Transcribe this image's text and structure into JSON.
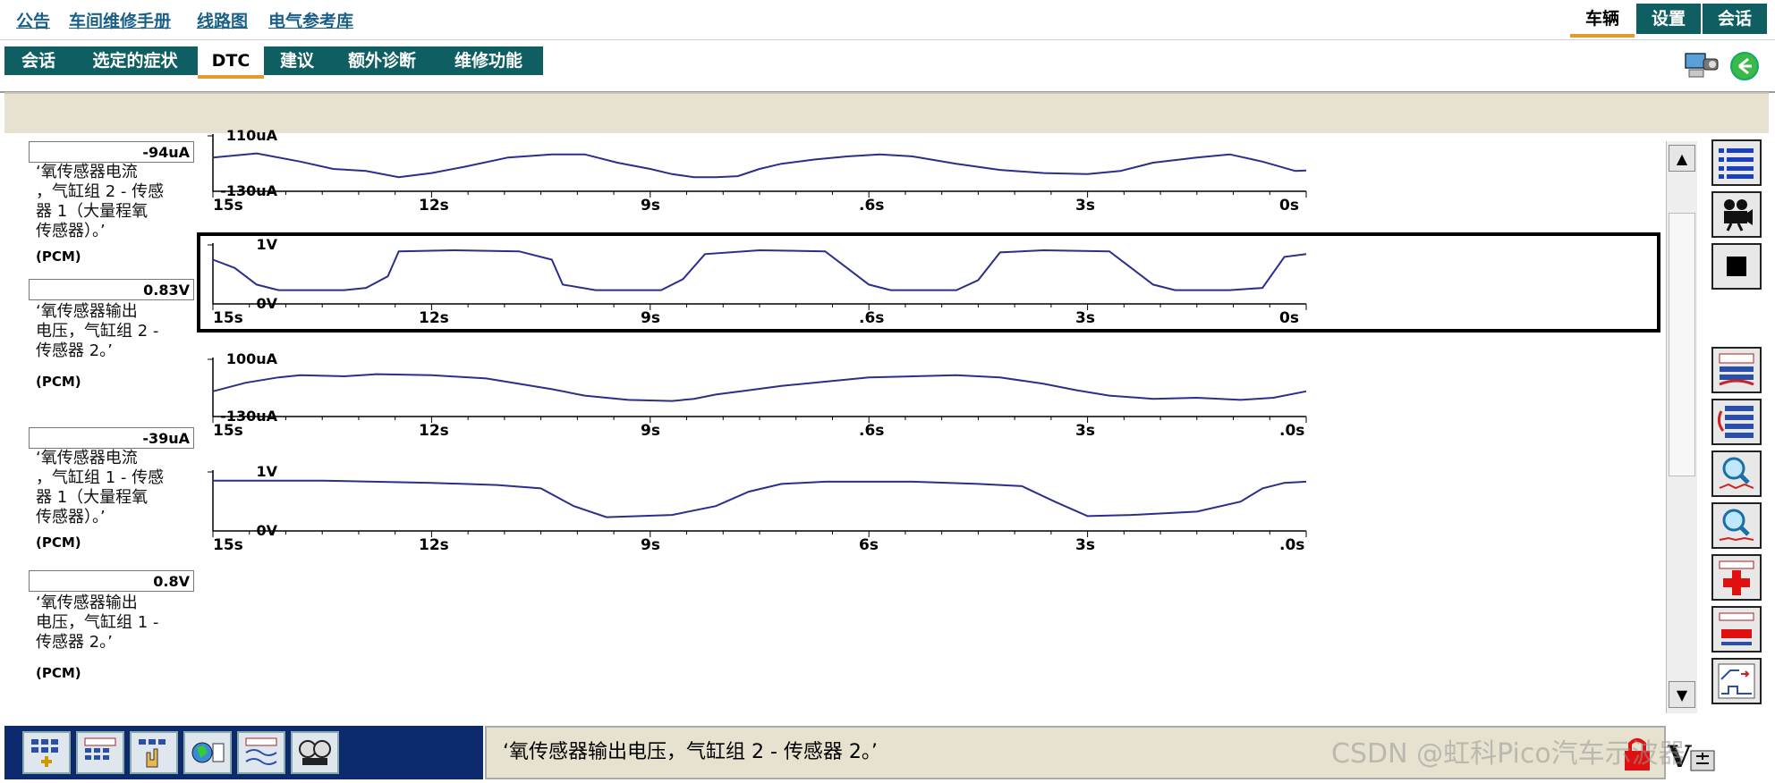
{
  "top_links": [
    "公告",
    "车间维修手册",
    "线路图",
    "电气参考库"
  ],
  "right_tabs": [
    {
      "label": "车辆",
      "active": true
    },
    {
      "label": "设置",
      "active": false
    },
    {
      "label": "会话",
      "active": false
    }
  ],
  "tabs": [
    {
      "label": "会话",
      "active": false
    },
    {
      "label": "选定的症状",
      "active": false
    },
    {
      "label": "DTC",
      "active": true
    },
    {
      "label": "建议",
      "active": false
    },
    {
      "label": "额外诊断",
      "active": false
    },
    {
      "label": "维修功能",
      "active": false
    }
  ],
  "graphs": [
    {
      "value": "-94uA",
      "name": "‘氧传感器电流\n，气缸组 2 - 传感\n器 1（大量程氧\n传感器）。’",
      "pcm": "(PCM)",
      "ymax": "110uA",
      "ymin": "-130uA",
      "selected": false,
      "x_labels": [
        "15s",
        "12s",
        "9s",
        ".6s",
        "3s",
        "0s"
      ]
    },
    {
      "value": "0.83V",
      "name": "‘氧传感器输出\n电压，气缸组 2 -\n传感器 2。’",
      "pcm": "(PCM)",
      "ymax": "1V",
      "ymin": "0V",
      "selected": true,
      "x_labels": [
        "15s",
        "12s",
        "9s",
        ".6s",
        "3s",
        "0s"
      ]
    },
    {
      "value": "-39uA",
      "name": "‘氧传感器电流\n，气缸组 1 - 传感\n器 1（大量程氧\n传感器）。’",
      "pcm": "(PCM)",
      "ymax": "100uA",
      "ymin": "-130uA",
      "selected": false,
      "x_labels": [
        "15s",
        "12s",
        "9s",
        ".6s",
        "3s",
        ".0s"
      ]
    },
    {
      "value": "0.8V",
      "name": "‘氧传感器输出\n电压，气缸组 1 -\n传感器 2。’",
      "pcm": "(PCM)",
      "ymax": "1V",
      "ymin": "0V",
      "selected": false,
      "x_labels": [
        "15s",
        "12s",
        "9s",
        "6s",
        "3s",
        ".0s"
      ]
    }
  ],
  "status_text": "‘氧传感器输出电压，气缸组 2 - 传感器 2。’",
  "watermark": "CSDN @虹科Pico汽车示波器",
  "colors": {
    "tab_bg": "#0f5f62",
    "accent": "#e39a2f",
    "trace": "#2a2f8a",
    "bottom_bar": "#0e2a6e",
    "beige": "#e7e2cf"
  },
  "icons": [
    "list-icon",
    "camera-icon",
    "stop-icon",
    "speed-icon",
    "list-refresh-icon",
    "zoom-in-icon",
    "zoom-out-icon",
    "add-icon",
    "remove-icon",
    "signal-icon"
  ]
}
